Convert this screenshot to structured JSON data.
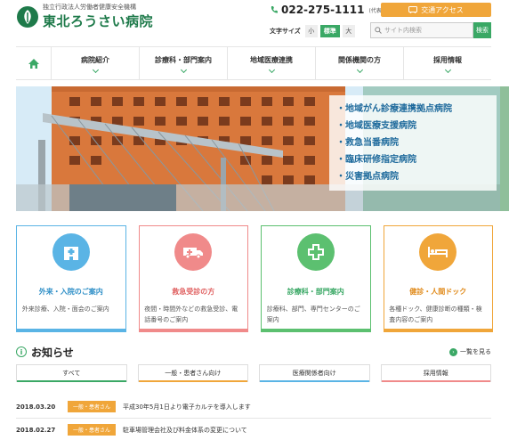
{
  "header": {
    "logo_sub": "独立行政法人労働者健康安全機構",
    "logo_main": "東北ろうさい病院",
    "phone": "022-275-1111",
    "phone_note": "(代表)",
    "access_label": "交通アクセス",
    "fontsize_label": "文字サイズ",
    "fontsize_small": "小",
    "fontsize_standard": "標準",
    "fontsize_large": "大",
    "search_placeholder": "サイト内検索",
    "search_button": "検索"
  },
  "nav": {
    "items": [
      {
        "label": "病院紹介"
      },
      {
        "label": "診療科・部門案内"
      },
      {
        "label": "地域医療連携"
      },
      {
        "label": "関係機関の方"
      },
      {
        "label": "採用情報"
      }
    ]
  },
  "hero": {
    "items": [
      "・地域がん診療連携拠点病院",
      "・地域医療支援病院",
      "・救急当番病院",
      "・臨床研修指定病院",
      "・災害拠点病院"
    ]
  },
  "cards": [
    {
      "title": "外来・入院のご案内",
      "desc": "外来診療、入院・面会のご案内",
      "color": "#5ab4e5",
      "icon": "hospital-icon"
    },
    {
      "title": "救急受診の方",
      "desc": "夜間・時間外などの救急受診、電話番号のご案内",
      "color": "#f08a8a",
      "icon": "ambulance-icon"
    },
    {
      "title": "診療科・部門案内",
      "desc": "診療科、部門、専門センターのご案内",
      "color": "#5cc070",
      "icon": "medical-cross-icon"
    },
    {
      "title": "健診・人間ドック",
      "desc": "各種ドック、健康診断の種類・検査内容のご案内",
      "color": "#f0a63a",
      "icon": "bed-icon"
    }
  ],
  "news": {
    "title": "お知らせ",
    "more": "一覧を見る",
    "tabs": [
      "すべて",
      "一般・患者さん向け",
      "医療関係者向け",
      "採用情報"
    ],
    "rows": [
      {
        "date": "2018.03.20",
        "badge": "一般・患者さん",
        "text": "平成30年5月1日より電子カルテを導入します"
      },
      {
        "date": "2018.02.27",
        "badge": "一般・患者さん",
        "text": "駐車場管理会社及び料金体系の変更について"
      }
    ]
  },
  "colors": {
    "brand_green": "#3aa865",
    "accent_orange": "#f0a63a"
  }
}
